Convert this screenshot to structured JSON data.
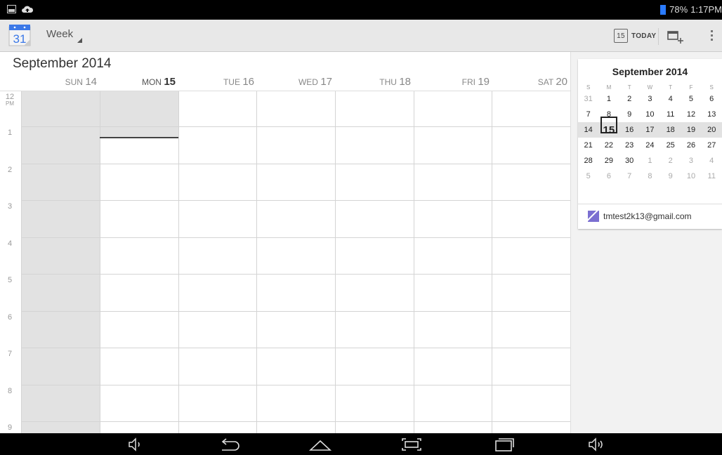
{
  "status_bar": {
    "battery_text": "78%",
    "time": "1:17PM",
    "icons": [
      "picture-icon",
      "cloud-upload-icon"
    ]
  },
  "action_bar": {
    "app_icon_day": "31",
    "view_mode": "Week",
    "today_icon_day": "15",
    "today_label": "TODAY",
    "new_event_icon": "new-event-icon",
    "overflow_icon": "overflow-menu-icon"
  },
  "calendar": {
    "month_title": "September 2014",
    "days": [
      {
        "dow": "SUN",
        "num": "14"
      },
      {
        "dow": "MON",
        "num": "15"
      },
      {
        "dow": "TUE",
        "num": "16"
      },
      {
        "dow": "WED",
        "num": "17"
      },
      {
        "dow": "THU",
        "num": "18"
      },
      {
        "dow": "FRI",
        "num": "19"
      },
      {
        "dow": "SAT",
        "num": "20"
      }
    ],
    "today_index": 1,
    "hours": [
      {
        "h": "12",
        "suffix": "PM"
      },
      {
        "h": "1",
        "suffix": ""
      },
      {
        "h": "2",
        "suffix": ""
      },
      {
        "h": "3",
        "suffix": ""
      },
      {
        "h": "4",
        "suffix": ""
      },
      {
        "h": "5",
        "suffix": ""
      },
      {
        "h": "6",
        "suffix": ""
      },
      {
        "h": "7",
        "suffix": ""
      },
      {
        "h": "8",
        "suffix": ""
      },
      {
        "h": "9",
        "suffix": ""
      }
    ]
  },
  "mini_calendar": {
    "title": "September 2014",
    "weekday_heads": [
      "S",
      "M",
      "T",
      "W",
      "T",
      "F",
      "S"
    ],
    "weeks": [
      [
        "31",
        "1",
        "2",
        "3",
        "4",
        "5",
        "6"
      ],
      [
        "7",
        "8",
        "9",
        "10",
        "11",
        "12",
        "13"
      ],
      [
        "14",
        "15",
        "16",
        "17",
        "18",
        "19",
        "20"
      ],
      [
        "21",
        "22",
        "23",
        "24",
        "25",
        "26",
        "27"
      ],
      [
        "28",
        "29",
        "30",
        "1",
        "2",
        "3",
        "4"
      ],
      [
        "5",
        "6",
        "7",
        "8",
        "9",
        "10",
        "11"
      ]
    ],
    "selected": "15",
    "account": "tmtest2k13@gmail.com",
    "account_color": "#7b6fd1"
  },
  "nav_bar": {
    "buttons": [
      "volume-down-icon",
      "back-icon",
      "home-icon",
      "screenshot-icon",
      "recent-apps-icon",
      "volume-up-icon"
    ]
  }
}
